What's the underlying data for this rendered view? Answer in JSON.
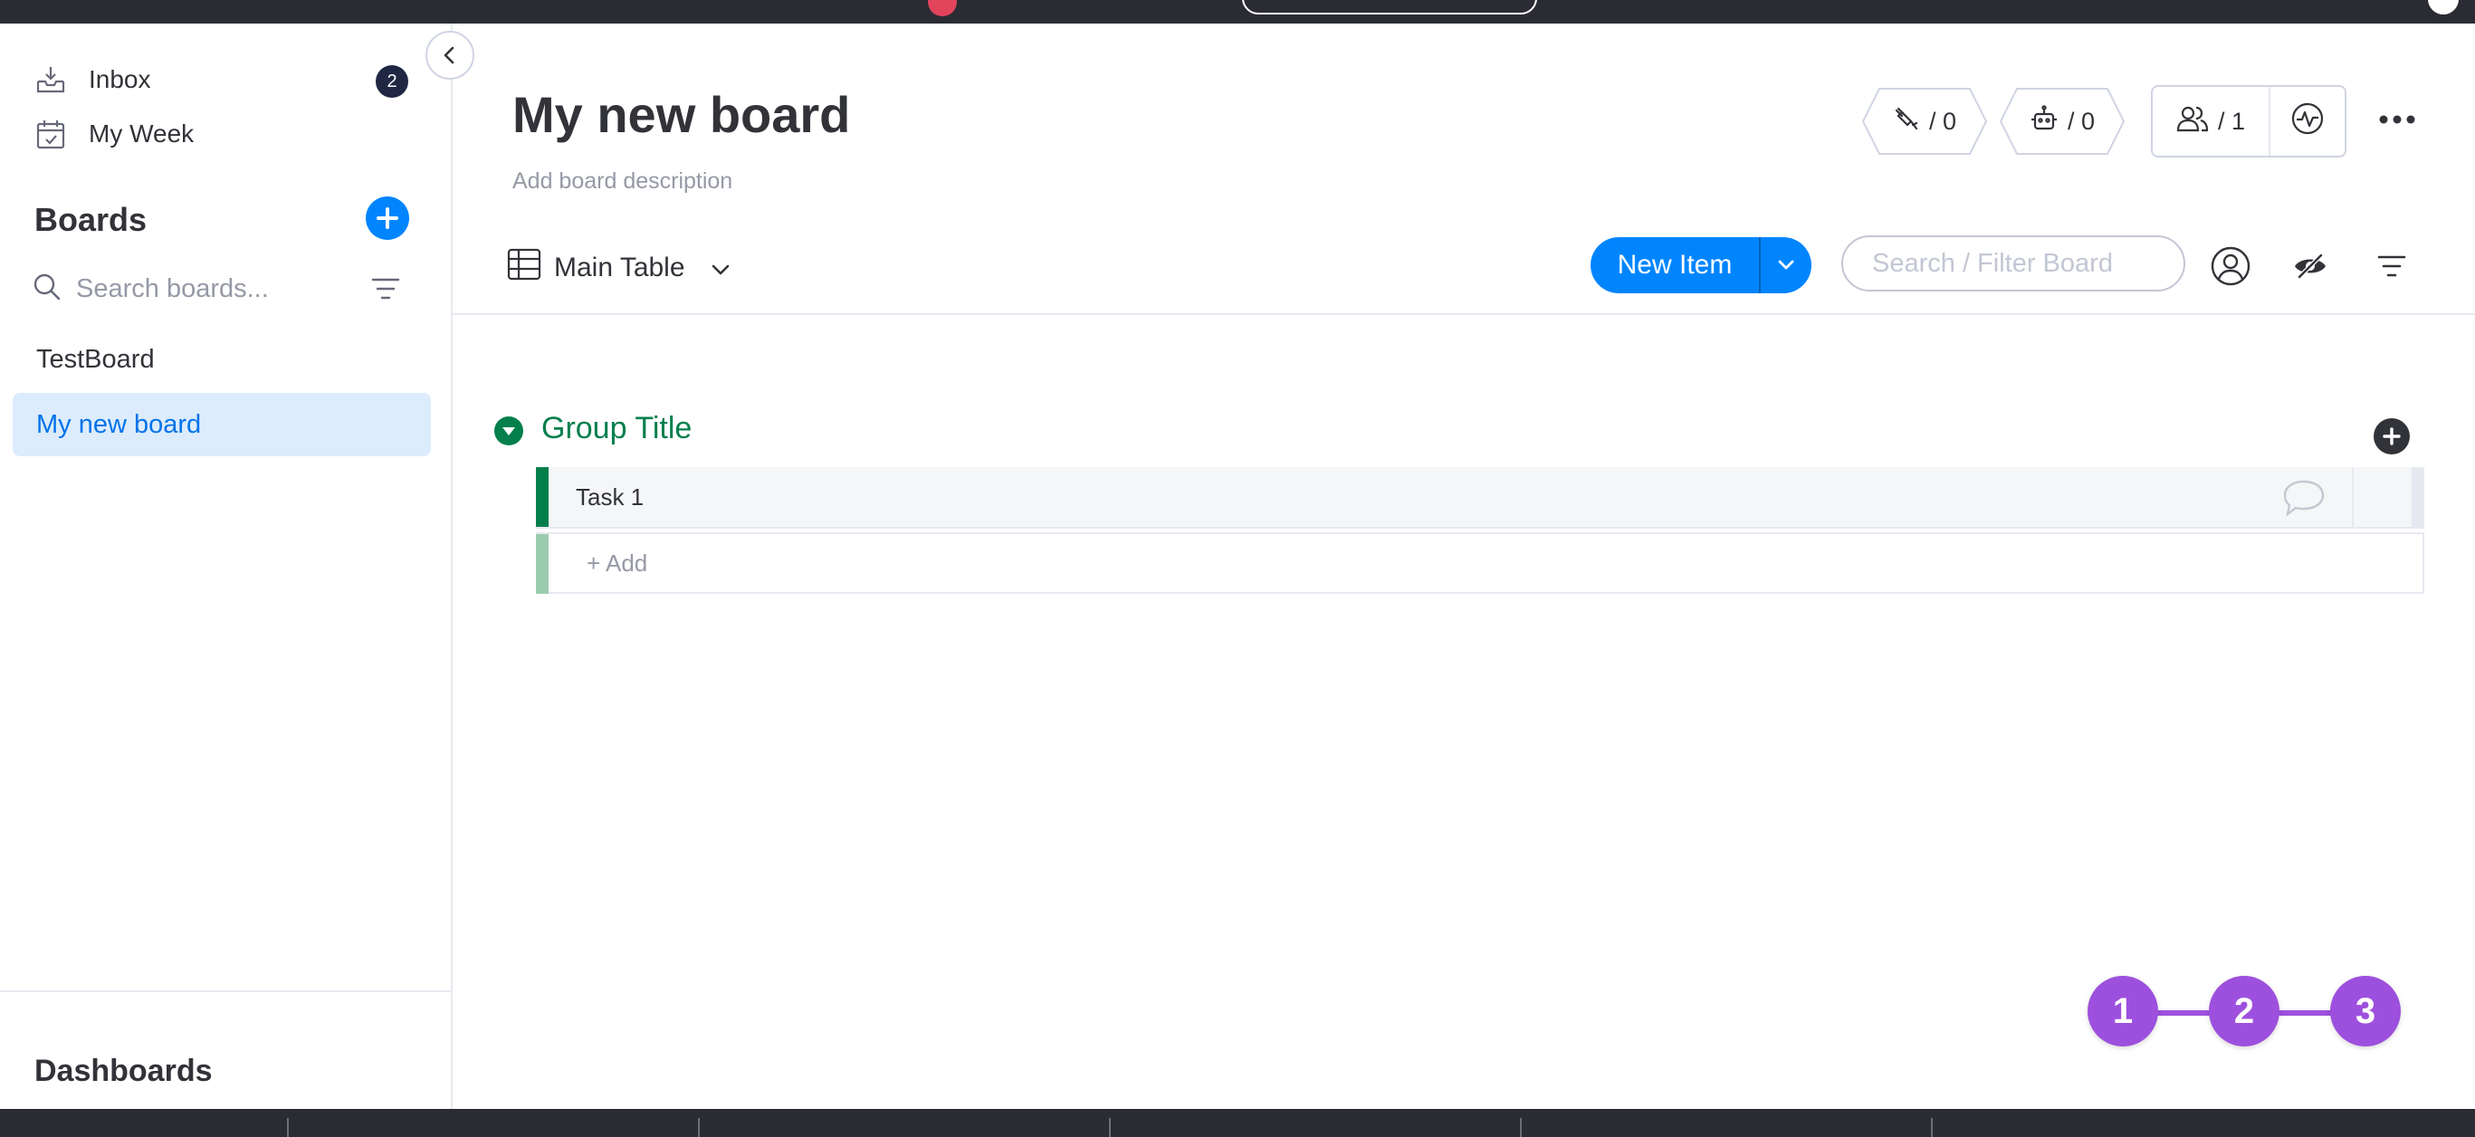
{
  "sidebar": {
    "inbox_label": "Inbox",
    "inbox_count": "2",
    "my_week_label": "My Week",
    "boards_title": "Boards",
    "search_placeholder": "Search boards...",
    "boards": [
      {
        "label": "TestBoard",
        "active": false
      },
      {
        "label": "My new board",
        "active": true
      }
    ],
    "dashboards_title": "Dashboards"
  },
  "board": {
    "title": "My new board",
    "description": "Add board description",
    "integrations_count": "/ 0",
    "automations_count": "/ 0",
    "members_count": "/ 1"
  },
  "toolbar": {
    "view_label": "Main Table",
    "new_item_label": "New Item",
    "search_placeholder": "Search / Filter Board"
  },
  "group": {
    "title": "Group Title",
    "color": "#037f4c",
    "items": [
      {
        "name": "Task 1"
      }
    ],
    "add_label": "+ Add"
  },
  "steps": [
    "1",
    "2",
    "3"
  ],
  "colors": {
    "primary": "#0085ff",
    "group_green": "#037f4c",
    "step_purple": "#9d50dd",
    "active_board_bg": "#dcecfd",
    "dark_bar": "#2b2c33"
  }
}
